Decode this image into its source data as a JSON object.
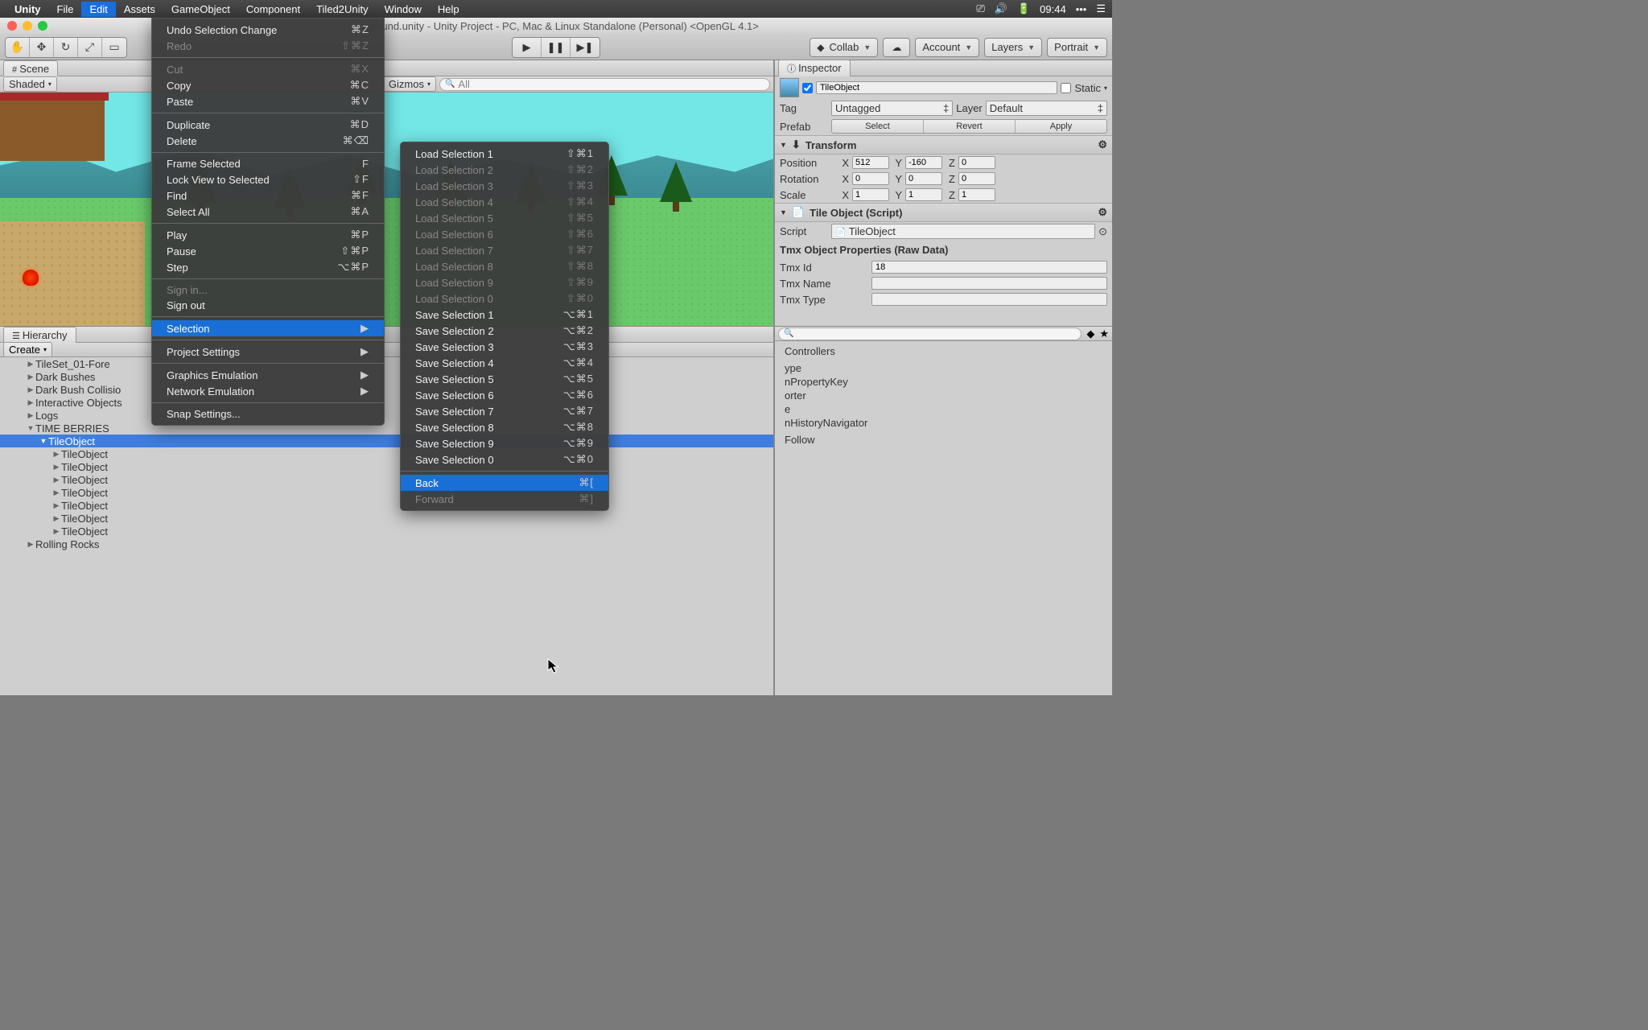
{
  "menubar": {
    "apple": "",
    "app": "Unity",
    "items": [
      "File",
      "Edit",
      "Assets",
      "GameObject",
      "Component",
      "Tiled2Unity",
      "Window",
      "Help"
    ],
    "active_index": 1,
    "clock": "09:44"
  },
  "window": {
    "title": "yground.unity - Unity Project - PC, Mac & Linux Standalone (Personal) <OpenGL 4.1>"
  },
  "toolbar": {
    "collab": "Collab",
    "account": "Account",
    "layers": "Layers",
    "layout": "Portrait"
  },
  "scene": {
    "tab": "Scene",
    "shading": "Shaded",
    "gizmos": "Gizmos",
    "search_placeholder": "All"
  },
  "hierarchy": {
    "tab": "Hierarchy",
    "create": "Create",
    "items": [
      {
        "indent": 2,
        "label": "TileSet_01-Fore",
        "arrow": "▶"
      },
      {
        "indent": 2,
        "label": "Dark Bushes",
        "arrow": "▶"
      },
      {
        "indent": 2,
        "label": "Dark Bush Collisio",
        "arrow": "▶"
      },
      {
        "indent": 2,
        "label": "Interactive Objects",
        "arrow": "▶"
      },
      {
        "indent": 2,
        "label": "Logs",
        "arrow": "▶"
      },
      {
        "indent": 2,
        "label": "TIME BERRIES",
        "arrow": "▼"
      },
      {
        "indent": 3,
        "label": "TileObject",
        "arrow": "▼",
        "sel": true
      },
      {
        "indent": 4,
        "label": "TileObject",
        "arrow": "▶"
      },
      {
        "indent": 4,
        "label": "TileObject",
        "arrow": "▶"
      },
      {
        "indent": 4,
        "label": "TileObject",
        "arrow": "▶"
      },
      {
        "indent": 4,
        "label": "TileObject",
        "arrow": "▶"
      },
      {
        "indent": 4,
        "label": "TileObject",
        "arrow": "▶"
      },
      {
        "indent": 4,
        "label": "TileObject",
        "arrow": "▶"
      },
      {
        "indent": 4,
        "label": "TileObject",
        "arrow": "▶"
      },
      {
        "indent": 2,
        "label": "Rolling Rocks",
        "arrow": "▶"
      }
    ]
  },
  "inspector": {
    "tab": "Inspector",
    "go_name": "TileObject",
    "static": "Static",
    "tag_label": "Tag",
    "tag_value": "Untagged",
    "layer_label": "Layer",
    "layer_value": "Default",
    "prefab_label": "Prefab",
    "prefab_select": "Select",
    "prefab_revert": "Revert",
    "prefab_apply": "Apply",
    "transform": {
      "title": "Transform",
      "pos_label": "Position",
      "pos": {
        "x": "512",
        "y": "-160",
        "z": "0"
      },
      "rot_label": "Rotation",
      "rot": {
        "x": "0",
        "y": "0",
        "z": "0"
      },
      "scl_label": "Scale",
      "scl": {
        "x": "1",
        "y": "1",
        "z": "1"
      }
    },
    "tileobj": {
      "title": "Tile Object (Script)",
      "script_label": "Script",
      "script_value": "TileObject",
      "raw_header": "Tmx Object Properties (Raw Data)",
      "id_label": "Tmx Id",
      "id_value": "18",
      "name_label": "Tmx Name",
      "name_value": "",
      "type_label": "Tmx Type",
      "type_value": ""
    }
  },
  "project": {
    "items": [
      "Controllers",
      "",
      "",
      "ype",
      "nPropertyKey",
      "orter",
      "e",
      "nHistoryNavigator",
      "",
      "",
      "Follow"
    ]
  },
  "edit_menu": {
    "items": [
      {
        "label": "Undo Selection Change",
        "sc": "⌘Z"
      },
      {
        "label": "Redo",
        "sc": "⇧⌘Z",
        "dis": true
      },
      {
        "sep": true
      },
      {
        "label": "Cut",
        "sc": "⌘X",
        "dis": true
      },
      {
        "label": "Copy",
        "sc": "⌘C"
      },
      {
        "label": "Paste",
        "sc": "⌘V"
      },
      {
        "sep": true
      },
      {
        "label": "Duplicate",
        "sc": "⌘D"
      },
      {
        "label": "Delete",
        "sc": "⌘⌫"
      },
      {
        "sep": true
      },
      {
        "label": "Frame Selected",
        "sc": "F"
      },
      {
        "label": "Lock View to Selected",
        "sc": "⇧F"
      },
      {
        "label": "Find",
        "sc": "⌘F"
      },
      {
        "label": "Select All",
        "sc": "⌘A"
      },
      {
        "sep": true
      },
      {
        "label": "Play",
        "sc": "⌘P"
      },
      {
        "label": "Pause",
        "sc": "⇧⌘P"
      },
      {
        "label": "Step",
        "sc": "⌥⌘P"
      },
      {
        "sep": true
      },
      {
        "label": "Sign in...",
        "dis": true
      },
      {
        "label": "Sign out"
      },
      {
        "sep": true
      },
      {
        "label": "Selection",
        "sub": true,
        "sel": true
      },
      {
        "sep": true
      },
      {
        "label": "Project Settings",
        "sub": true
      },
      {
        "sep": true
      },
      {
        "label": "Graphics Emulation",
        "sub": true
      },
      {
        "label": "Network Emulation",
        "sub": true
      },
      {
        "sep": true
      },
      {
        "label": "Snap Settings..."
      }
    ]
  },
  "selection_submenu": {
    "items": [
      {
        "label": "Load Selection 1",
        "sc": "⇧⌘1"
      },
      {
        "label": "Load Selection 2",
        "sc": "⇧⌘2",
        "dis": true
      },
      {
        "label": "Load Selection 3",
        "sc": "⇧⌘3",
        "dis": true
      },
      {
        "label": "Load Selection 4",
        "sc": "⇧⌘4",
        "dis": true
      },
      {
        "label": "Load Selection 5",
        "sc": "⇧⌘5",
        "dis": true
      },
      {
        "label": "Load Selection 6",
        "sc": "⇧⌘6",
        "dis": true
      },
      {
        "label": "Load Selection 7",
        "sc": "⇧⌘7",
        "dis": true
      },
      {
        "label": "Load Selection 8",
        "sc": "⇧⌘8",
        "dis": true
      },
      {
        "label": "Load Selection 9",
        "sc": "⇧⌘9",
        "dis": true
      },
      {
        "label": "Load Selection 0",
        "sc": "⇧⌘0",
        "dis": true
      },
      {
        "label": "Save Selection 1",
        "sc": "⌥⌘1"
      },
      {
        "label": "Save Selection 2",
        "sc": "⌥⌘2"
      },
      {
        "label": "Save Selection 3",
        "sc": "⌥⌘3"
      },
      {
        "label": "Save Selection 4",
        "sc": "⌥⌘4"
      },
      {
        "label": "Save Selection 5",
        "sc": "⌥⌘5"
      },
      {
        "label": "Save Selection 6",
        "sc": "⌥⌘6"
      },
      {
        "label": "Save Selection 7",
        "sc": "⌥⌘7"
      },
      {
        "label": "Save Selection 8",
        "sc": "⌥⌘8"
      },
      {
        "label": "Save Selection 9",
        "sc": "⌥⌘9"
      },
      {
        "label": "Save Selection 0",
        "sc": "⌥⌘0"
      },
      {
        "sep": true
      },
      {
        "label": "Back",
        "sc": "⌘[",
        "sel": true
      },
      {
        "label": "Forward",
        "sc": "⌘]",
        "dis": true
      }
    ]
  }
}
